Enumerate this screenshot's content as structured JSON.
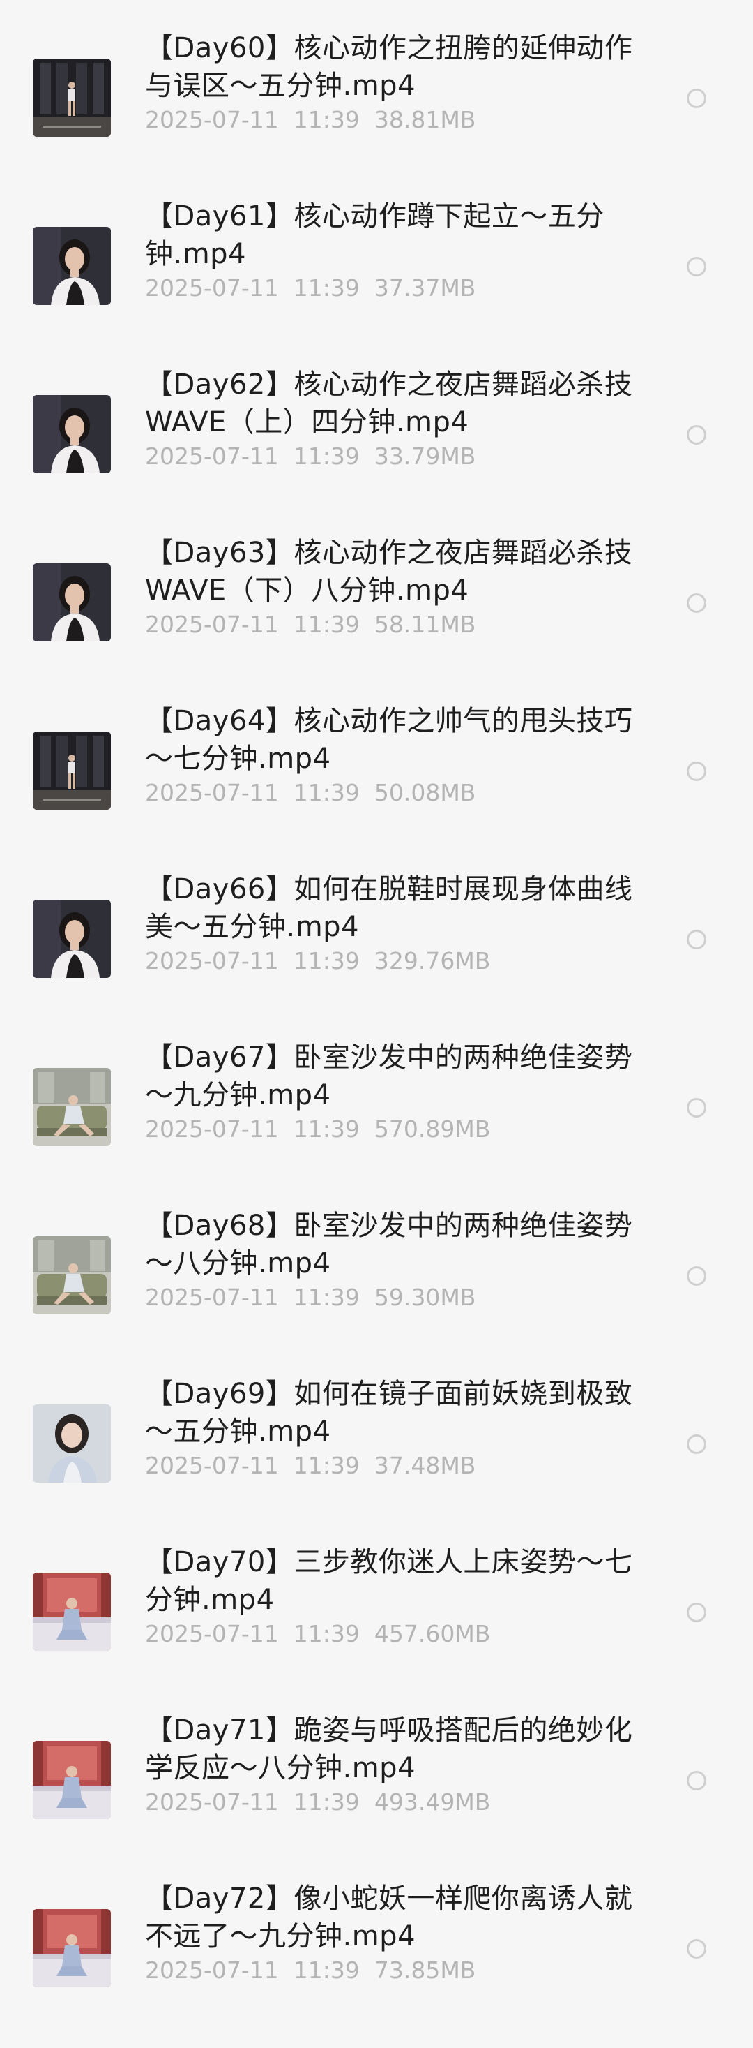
{
  "files": [
    {
      "title": "【Day60】核心动作之扭胯的延伸动作与误区～五分钟.mp4",
      "date": "2025-07-11",
      "time": "11:39",
      "size": "38.81MB",
      "thumb": "studio-dark"
    },
    {
      "title": "【Day61】核心动作蹲下起立～五分钟.mp4",
      "date": "2025-07-11",
      "time": "11:39",
      "size": "37.37MB",
      "thumb": "portrait-dark"
    },
    {
      "title": "【Day62】核心动作之夜店舞蹈必杀技WAVE（上）四分钟.mp4",
      "date": "2025-07-11",
      "time": "11:39",
      "size": "33.79MB",
      "thumb": "portrait-dark"
    },
    {
      "title": "【Day63】核心动作之夜店舞蹈必杀技WAVE（下）八分钟.mp4",
      "date": "2025-07-11",
      "time": "11:39",
      "size": "58.11MB",
      "thumb": "portrait-dark"
    },
    {
      "title": "【Day64】核心动作之帅气的甩头技巧～七分钟.mp4",
      "date": "2025-07-11",
      "time": "11:39",
      "size": "50.08MB",
      "thumb": "studio-dark"
    },
    {
      "title": "【Day66】如何在脱鞋时展现身体曲线美～五分钟.mp4",
      "date": "2025-07-11",
      "time": "11:39",
      "size": "329.76MB",
      "thumb": "portrait-dark"
    },
    {
      "title": "【Day67】卧室沙发中的两种绝佳姿势～九分钟.mp4",
      "date": "2025-07-11",
      "time": "11:39",
      "size": "570.89MB",
      "thumb": "sofa"
    },
    {
      "title": "【Day68】卧室沙发中的两种绝佳姿势～八分钟.mp4",
      "date": "2025-07-11",
      "time": "11:39",
      "size": "59.30MB",
      "thumb": "sofa"
    },
    {
      "title": "【Day69】如何在镜子面前妖娆到极致～五分钟.mp4",
      "date": "2025-07-11",
      "time": "11:39",
      "size": "37.48MB",
      "thumb": "mirror"
    },
    {
      "title": "【Day70】三步教你迷人上床姿势～七分钟.mp4",
      "date": "2025-07-11",
      "time": "11:39",
      "size": "457.60MB",
      "thumb": "bed-red"
    },
    {
      "title": "【Day71】跪姿与呼吸搭配后的绝妙化学反应～八分钟.mp4",
      "date": "2025-07-11",
      "time": "11:39",
      "size": "493.49MB",
      "thumb": "bed-red"
    },
    {
      "title": "【Day72】像小蛇妖一样爬你离诱人就不远了～九分钟.mp4",
      "date": "2025-07-11",
      "time": "11:39",
      "size": "73.85MB",
      "thumb": "bed-red"
    }
  ],
  "colors": {
    "background": "#f6f6f6",
    "title_text": "#1e1e1e",
    "meta_text": "#b4b4b4",
    "radio_border": "#cfcfcf"
  }
}
